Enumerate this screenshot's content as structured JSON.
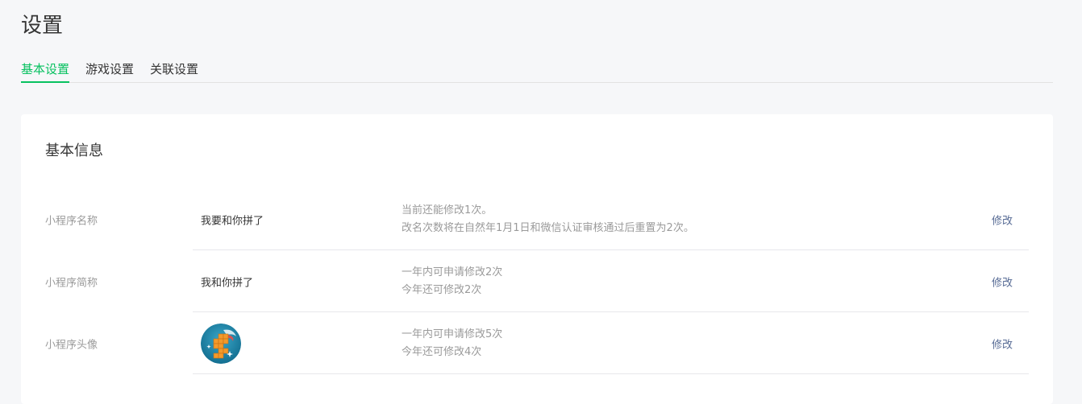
{
  "header": {
    "title": "设置"
  },
  "tabs": [
    {
      "label": "基本设置",
      "active": true
    },
    {
      "label": "游戏设置",
      "active": false
    },
    {
      "label": "关联设置",
      "active": false
    }
  ],
  "colors": {
    "accent": "#07c160",
    "link": "#576b95"
  },
  "basic_info": {
    "title": "基本信息",
    "rows": [
      {
        "label": "小程序名称",
        "value": "我要和你拼了",
        "desc": [
          "当前还能修改1次。",
          "改名次数将在自然年1月1日和微信认证审核通过后重置为2次。"
        ],
        "action": "修改"
      },
      {
        "label": "小程序简称",
        "value": "我和你拼了",
        "desc": [
          "一年内可申请修改2次",
          "今年还可修改2次"
        ],
        "action": "修改"
      },
      {
        "label": "小程序头像",
        "value_icon": "app-avatar-icon",
        "desc": [
          "一年内可申请修改5次",
          "今年还可修改4次"
        ],
        "action": "修改"
      }
    ]
  }
}
